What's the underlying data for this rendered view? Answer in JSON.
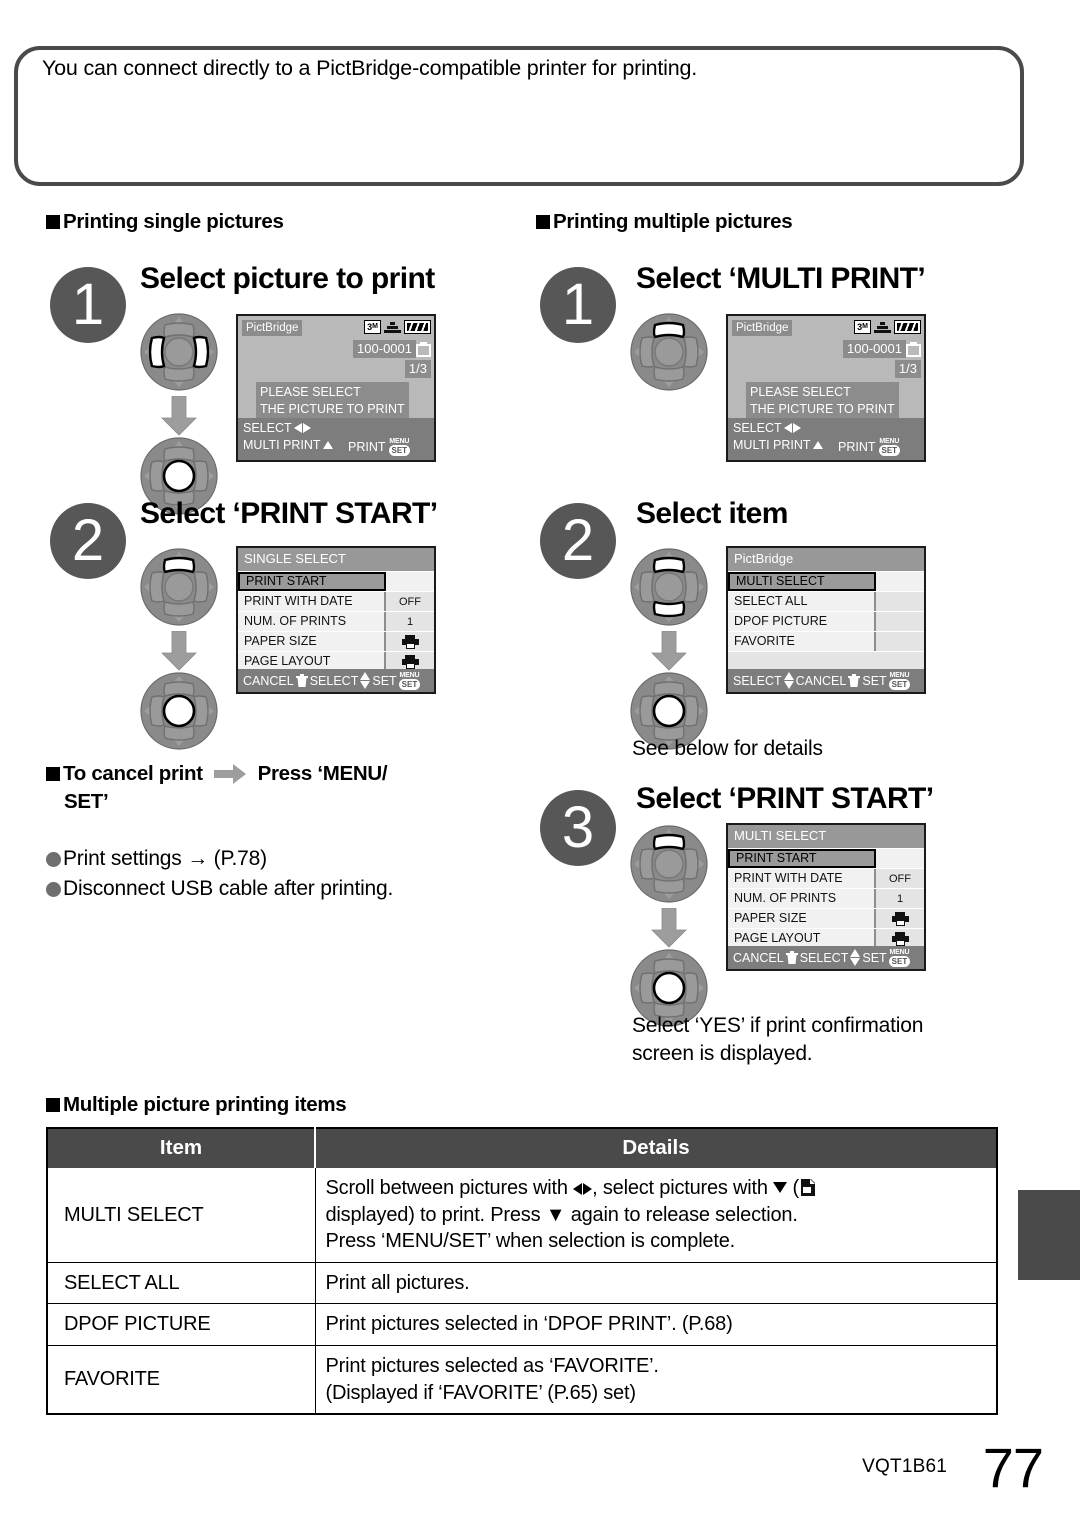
{
  "intro": {
    "text": "You can connect directly to a PictBridge-compatible printer for printing."
  },
  "sections": {
    "single_heading": "Printing single pictures",
    "multiple_heading": "Printing multiple pictures",
    "items_heading": "Multiple picture printing items"
  },
  "left_column": {
    "step1": {
      "number": "1",
      "title": "Select picture to print",
      "screen": {
        "type": "preview",
        "tag": "PictBridge",
        "resolution": "3",
        "resolution_unit": "M",
        "file_number": "100-0001",
        "frame_counter": "1/3",
        "message_line1": "PLEASE SELECT",
        "message_line2": "THE PICTURE TO PRINT",
        "hint_select": "SELECT",
        "hint_multi": "MULTI PRINT",
        "hint_print": "PRINT",
        "badge_top": "MENU",
        "badge_bottom": "SET"
      }
    },
    "step2": {
      "number": "2",
      "title": "Select ‘PRINT START’",
      "screen": {
        "type": "menu",
        "header": "SINGLE SELECT",
        "rows": [
          {
            "label": "PRINT START",
            "value": "",
            "selected": true
          },
          {
            "label": "PRINT WITH DATE",
            "value": "OFF",
            "selected": false
          },
          {
            "label": "NUM. OF PRINTS",
            "value": "1",
            "selected": false
          },
          {
            "label": "PAPER SIZE",
            "value": "printer-icon",
            "selected": false
          },
          {
            "label": "PAGE LAYOUT",
            "value": "printer-icon",
            "selected": false
          }
        ],
        "footer_cancel": "CANCEL",
        "footer_select": "SELECT",
        "footer_set": "SET",
        "badge_top": "MENU",
        "badge_bottom": "SET"
      }
    },
    "cancel_heading_a": "To cancel print",
    "cancel_heading_b": "Press ‘MENU/",
    "cancel_heading_c": "SET’",
    "note1": "Print settings → (P.78)",
    "note2": "Disconnect USB cable after printing."
  },
  "right_column": {
    "step1": {
      "number": "1",
      "title": "Select ‘MULTI PRINT’",
      "screen": {
        "type": "preview",
        "tag": "PictBridge",
        "resolution": "3",
        "resolution_unit": "M",
        "file_number": "100-0001",
        "frame_counter": "1/3",
        "message_line1": "PLEASE SELECT",
        "message_line2": "THE PICTURE TO PRINT",
        "hint_select": "SELECT",
        "hint_multi": "MULTI PRINT",
        "hint_print": "PRINT",
        "badge_top": "MENU",
        "badge_bottom": "SET"
      }
    },
    "step2": {
      "number": "2",
      "title": "Select item",
      "screen": {
        "type": "menu",
        "header": "PictBridge",
        "rows": [
          {
            "label": "MULTI SELECT",
            "value": "",
            "selected": true
          },
          {
            "label": "SELECT ALL",
            "value": "",
            "selected": false
          },
          {
            "label": "DPOF PICTURE",
            "value": "",
            "selected": false
          },
          {
            "label": "FAVORITE",
            "value": "",
            "selected": false
          },
          {
            "label": "",
            "value": "",
            "selected": false
          }
        ],
        "footer_select": "SELECT",
        "footer_cancel": "CANCEL",
        "footer_set": "SET",
        "badge_top": "MENU",
        "badge_bottom": "SET"
      },
      "after_note": "See below for details"
    },
    "step3": {
      "number": "3",
      "title": "Select ‘PRINT START’",
      "screen": {
        "type": "menu",
        "header": "MULTI SELECT",
        "rows": [
          {
            "label": "PRINT START",
            "value": "",
            "selected": true
          },
          {
            "label": "PRINT WITH DATE",
            "value": "OFF",
            "selected": false
          },
          {
            "label": "NUM. OF PRINTS",
            "value": "1",
            "selected": false
          },
          {
            "label": "PAPER SIZE",
            "value": "printer-icon",
            "selected": false
          },
          {
            "label": "PAGE LAYOUT",
            "value": "printer-icon",
            "selected": false
          }
        ],
        "footer_cancel": "CANCEL",
        "footer_select": "SELECT",
        "footer_set": "SET",
        "badge_top": "MENU",
        "badge_bottom": "SET"
      },
      "after_note_line1": "Select ‘YES’ if print confirmation",
      "after_note_line2": "screen is displayed."
    }
  },
  "table": {
    "headers": {
      "item": "Item",
      "details": "Details"
    },
    "rows": [
      {
        "item": "MULTI SELECT",
        "details_line1_a": "Scroll between pictures with",
        "details_line1_b": ", select pictures with",
        "details_line1_c": "(",
        "details_line2": "displayed) to print. Press ▼ again to release selection.",
        "details_line3": "Press ‘MENU/SET’ when selection is complete."
      },
      {
        "item": "SELECT ALL",
        "details_line1": "Print all pictures."
      },
      {
        "item": "DPOF PICTURE",
        "details_line1": "Print pictures selected in ‘DPOF PRINT’. (P.68)"
      },
      {
        "item": "FAVORITE",
        "details_line1": "Print pictures selected as ‘FAVORITE’.",
        "details_line2": "(Displayed if ‘FAVORITE’ (P.65) set)"
      }
    ]
  },
  "footer": {
    "code": "VQT1B61",
    "page": "77"
  }
}
